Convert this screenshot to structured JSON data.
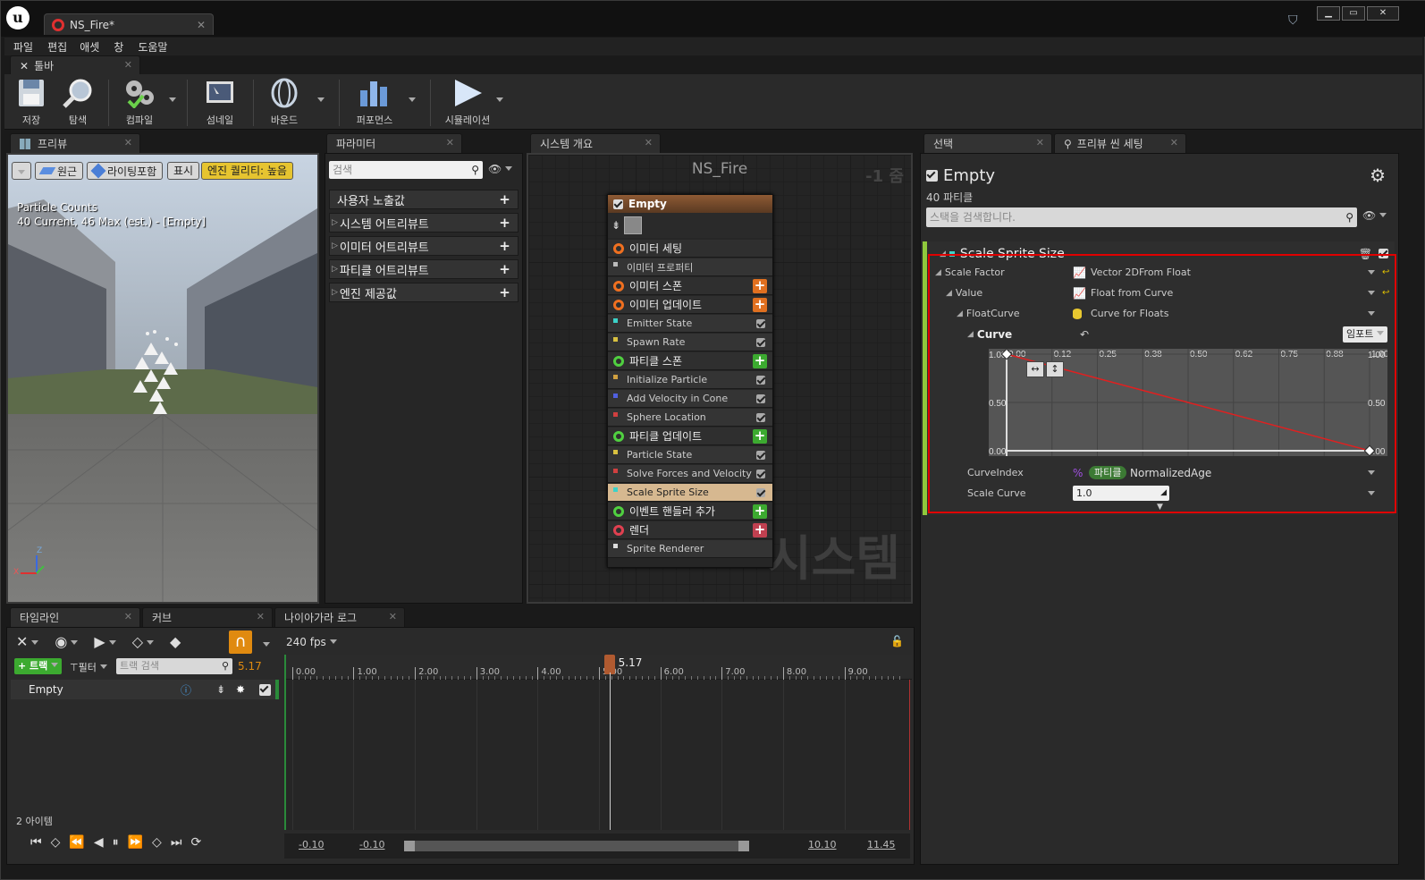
{
  "window": {
    "doc_tab": "NS_Fire*",
    "controls": [
      "▁",
      "▭",
      "✕"
    ]
  },
  "menu": [
    "파일",
    "편집",
    "애셋",
    "창",
    "도움말"
  ],
  "toolbar": {
    "tab_label": "툴바",
    "buttons": [
      {
        "label": "저장",
        "icon": "save-icon"
      },
      {
        "label": "탐색",
        "icon": "browse-icon"
      },
      {
        "label": "컴파일",
        "icon": "compile-icon"
      },
      {
        "label": "섬네일",
        "icon": "thumbnail-icon"
      },
      {
        "label": "바운드",
        "icon": "bounds-icon"
      },
      {
        "label": "퍼포먼스",
        "icon": "performance-icon"
      },
      {
        "label": "시뮬레이션",
        "icon": "play-icon"
      }
    ]
  },
  "preview": {
    "tab_label": "프리뷰",
    "btn_perspective": "원근",
    "btn_lit": "라이팅포함",
    "btn_show": "표시",
    "btn_quality": "엔진 퀄리티: 높음",
    "stats_title": "Particle Counts",
    "stats_line": "40 Current, 46 Max (est.) - [Empty]",
    "axis_z": "Z",
    "axis_x": "X"
  },
  "parameters": {
    "tab_label": "파라미터",
    "search_placeholder": "검색",
    "items": [
      "사용자 노출값",
      "시스템 어트리뷰트",
      "이미터 어트리뷰트",
      "파티클 어트리뷰트",
      "엔진 제공값"
    ]
  },
  "system_overview": {
    "tab_label": "시스템 개요",
    "title": "NS_Fire",
    "zoom_text": "-1 줌",
    "watermark": "시스템",
    "node": {
      "name": "Empty",
      "rows": [
        {
          "label": "이미터 세팅",
          "kind": "section",
          "color": "#f07020",
          "icon": "gear-icon",
          "plus": false
        },
        {
          "label": "이미터 프로퍼티",
          "kind": "item",
          "color": "#bbbbbb",
          "icon": "cpu-icon"
        },
        {
          "label": "이미터 스폰",
          "kind": "section",
          "color": "#f07020",
          "icon": "spawn-icon",
          "plus": true,
          "plus_color": "#e07020"
        },
        {
          "label": "이미터 업데이트",
          "kind": "section",
          "color": "#f07020",
          "icon": "update-icon",
          "plus": true,
          "plus_color": "#e07020"
        },
        {
          "label": "Emitter State",
          "kind": "item",
          "color": "#3cd2c8"
        },
        {
          "label": "Spawn Rate",
          "kind": "item",
          "color": "#d8c040"
        },
        {
          "label": "파티클 스폰",
          "kind": "section",
          "color": "#50d040",
          "icon": "spawn-icon",
          "plus": true,
          "plus_color": "#3caa30"
        },
        {
          "label": "Initialize Particle",
          "kind": "item",
          "color": "#d0a040"
        },
        {
          "label": "Add Velocity in Cone",
          "kind": "item",
          "color": "#5060e0"
        },
        {
          "label": "Sphere Location",
          "kind": "item",
          "color": "#d04040"
        },
        {
          "label": "파티클 업데이트",
          "kind": "section",
          "color": "#50d040",
          "icon": "update-icon",
          "plus": true,
          "plus_color": "#3caa30"
        },
        {
          "label": "Particle State",
          "kind": "item",
          "color": "#d8c040"
        },
        {
          "label": "Solve Forces and Velocity",
          "kind": "item",
          "color": "#d04040"
        },
        {
          "label": "Scale Sprite Size",
          "kind": "item",
          "color": "#3cd2c8",
          "selected": true
        },
        {
          "label": "이벤트 핸들러 추가",
          "kind": "section",
          "color": "#50d040",
          "icon": "event-icon",
          "plus": true,
          "plus_color": "#3caa30"
        },
        {
          "label": "렌더",
          "kind": "section",
          "color": "#e04050",
          "icon": "render-icon",
          "plus": true,
          "plus_color": "#c04050"
        },
        {
          "label": "Sprite Renderer",
          "kind": "item",
          "color": "#dddddd",
          "icon": "sprite-icon"
        }
      ]
    }
  },
  "selection": {
    "tab_label": "선택",
    "tab2_label": "프리뷰 씬 세팅",
    "title": "Empty",
    "subtitle": "40 파티클",
    "search_placeholder": "스택을 검색합니다.",
    "module_title": "Scale Sprite Size",
    "props": {
      "scale_factor_label": "Scale Factor",
      "scale_factor_value": "Vector 2DFrom Float",
      "value_label": "Value",
      "value_value": "Float from Curve",
      "floatcurve_label": "FloatCurve",
      "floatcurve_value": "Curve for Floats",
      "curve_label": "Curve",
      "import_label": "임포트",
      "curveindex_label": "CurveIndex",
      "curveindex_badge": "파티클",
      "curveindex_value": "NormalizedAge",
      "scalecurve_label": "Scale Curve",
      "scalecurve_value": "1.0"
    },
    "curve": {
      "x_ticks": [
        "0.00",
        "0.12",
        "0.25",
        "0.38",
        "0.50",
        "0.62",
        "0.75",
        "0.88",
        "1.00"
      ],
      "y_left": [
        "1.00",
        "0.50",
        "0.00"
      ],
      "y_right": [
        "1.00",
        "0.50",
        "0.00"
      ],
      "points": [
        [
          0,
          1
        ],
        [
          1,
          0
        ]
      ]
    }
  },
  "timeline": {
    "tab_label": "타임라인",
    "tab_curve": "커브",
    "tab_log": "나이아가라 로그",
    "fps": "240 fps",
    "track_btn": "트랙",
    "filter_btn": "필터",
    "search_placeholder": "트랙 검색",
    "current_time_field": "5.17",
    "track_name": "Empty",
    "item_count": "2 아이템",
    "ruler_ticks": [
      "0.00",
      "1.00",
      "2.00",
      "3.00",
      "4.00",
      "5.00",
      "6.00",
      "7.00",
      "8.00",
      "9.00"
    ],
    "playhead": "5.17",
    "range_start": "-0.10",
    "view_start": "-0.10",
    "view_end": "10.10",
    "range_end": "11.45"
  }
}
